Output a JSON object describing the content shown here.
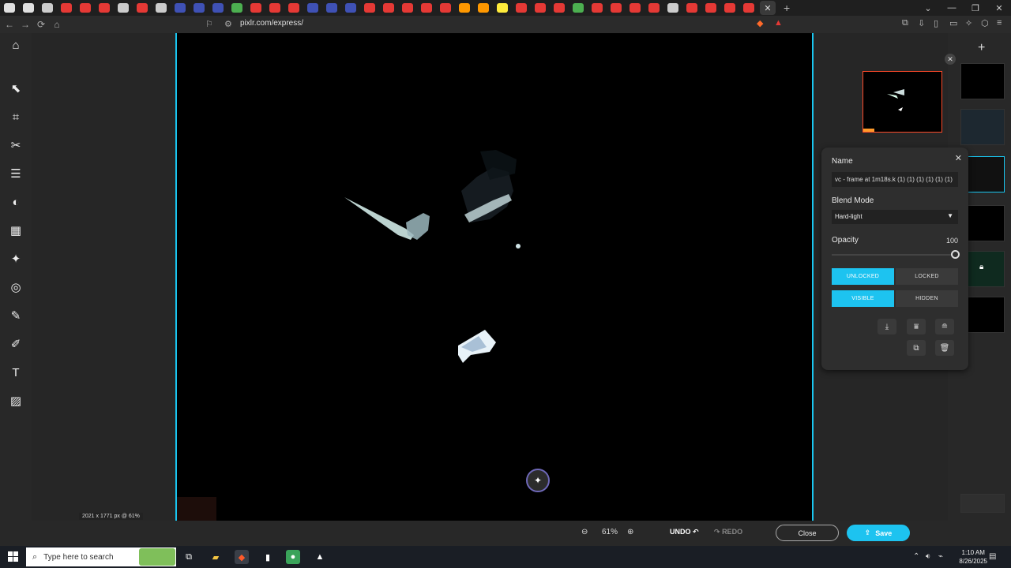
{
  "browser": {
    "url": "pixlr.com/express/",
    "tab_favicon_colors": [
      "#e0e0e0",
      "#e0e0e0",
      "#cccccc",
      "#e53935",
      "#e53935",
      "#e53935",
      "#cccccc",
      "#e53935",
      "#cccccc",
      "#3f51b5",
      "#3f51b5",
      "#3f51b5",
      "#4caf50",
      "#e53935",
      "#e53935",
      "#e53935",
      "#3f51b5",
      "#3f51b5",
      "#3f51b5",
      "#e53935",
      "#e53935",
      "#e53935",
      "#e53935",
      "#e53935",
      "#ff9800",
      "#ff9800",
      "#ffeb3b",
      "#e53935",
      "#e53935",
      "#e53935",
      "#4caf50",
      "#e53935",
      "#e53935",
      "#e53935",
      "#e53935",
      "#cccccc",
      "#e53935",
      "#e53935",
      "#e53935",
      "#e53935"
    ]
  },
  "toolbar": {
    "tools": [
      "home-icon",
      "arrange-icon",
      "crop-icon",
      "cutout-icon",
      "adjust-icon",
      "filter-icon",
      "effect-icon",
      "retouch-icon",
      "liquify-icon",
      "heal-icon",
      "draw-icon",
      "text-icon",
      "pattern-icon"
    ]
  },
  "canvas": {
    "dims_label": "2021 x 1771 px @ 61%"
  },
  "layer_panel": {
    "name_label": "Name",
    "name_value": "vc - frame at 1m18s.k (1) (1) (1) (1) (1) (1)",
    "blend_label": "Blend Mode",
    "blend_value": "Hard-light",
    "opacity_label": "Opacity",
    "opacity_value": "100",
    "opacity_fraction": 1.0,
    "unlocked": "UNLOCKED",
    "locked": "LOCKED",
    "visible": "VISIBLE",
    "hidden": "HIDDEN"
  },
  "bottom": {
    "zoom_value": "61%",
    "undo": "UNDO",
    "redo": "REDO",
    "close": "Close",
    "save": "Save"
  },
  "taskbar": {
    "search_placeholder": "Type here to search",
    "time": "1:10 AM",
    "date": "8/26/2025"
  }
}
